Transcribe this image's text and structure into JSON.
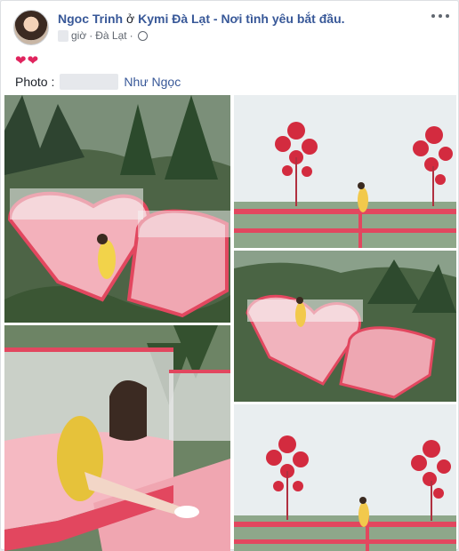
{
  "post": {
    "author": "Ngoc Trinh",
    "at_word": "ở",
    "location": "Kymi Đà Lạt - Nơi tình yêu bắt đầu.",
    "time_suffix": "giờ",
    "separator": "·",
    "place": "Đà Lạt",
    "hearts": "❤❤",
    "photo_label": "Photo :",
    "tagged": "Như Ngọc",
    "icons": {
      "privacy": "globe-icon",
      "menu": "more-options-icon"
    }
  },
  "colors": {
    "link": "#385898",
    "heart": "#e0245e",
    "platform": "#ff6e86",
    "sky": "#e8eef2",
    "forest": "#3f5a3a"
  }
}
